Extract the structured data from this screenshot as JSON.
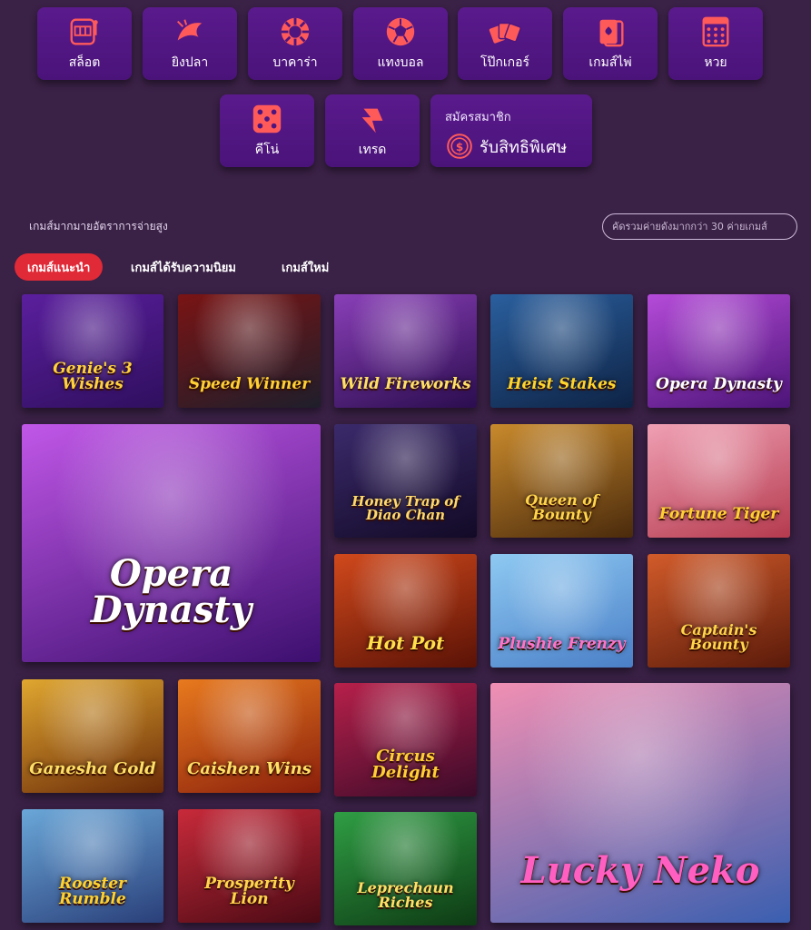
{
  "categories": [
    {
      "label": "สล็อต",
      "icon": "slot-machine-icon"
    },
    {
      "label": "ยิงปลา",
      "icon": "fish-icon"
    },
    {
      "label": "บาคาร่า",
      "icon": "baccarat-chip-icon"
    },
    {
      "label": "แทงบอล",
      "icon": "soccer-ball-icon"
    },
    {
      "label": "โป๊กเกอร์",
      "icon": "poker-cards-icon"
    },
    {
      "label": "เกมส์ไพ่",
      "icon": "playing-cards-icon"
    },
    {
      "label": "หวย",
      "icon": "lottery-ticket-icon"
    },
    {
      "label": "คีโน่",
      "icon": "dice-icon"
    },
    {
      "label": "เทรด",
      "icon": "trade-chart-icon"
    }
  ],
  "member": {
    "top": "สมัครสมาชิก",
    "main": "รับสิทธิพิเศษ",
    "icon": "coin-icon"
  },
  "section": {
    "title": "เกมส์มากมายอัตราการจ่ายสูง",
    "search_placeholder": "คัดรวมค่ายดังมากกว่า 30 ค่ายเกมส์"
  },
  "tabs": [
    {
      "label": "เกมส์แนะนำ",
      "active": true
    },
    {
      "label": "เกมส์ได้รับความนิยม",
      "active": false
    },
    {
      "label": "เกมส์ใหม่",
      "active": false
    }
  ],
  "games": [
    {
      "name": "Genie's 3 Wishes",
      "colors": [
        "#5b1f9e",
        "#2f0f5e"
      ],
      "text": "#ffd23d"
    },
    {
      "name": "Speed Winner",
      "colors": [
        "#7a1414",
        "#1e1e2b"
      ],
      "text": "#ffcf33"
    },
    {
      "name": "Wild Fireworks",
      "colors": [
        "#8a3fb8",
        "#2b0d4f"
      ],
      "text": "#ffe066"
    },
    {
      "name": "Heist Stakes",
      "colors": [
        "#2a5f9e",
        "#0e2345"
      ],
      "text": "#ffd52b"
    },
    {
      "name": "Opera Dynasty",
      "colors": [
        "#b54bd9",
        "#4c1478"
      ],
      "text": "#ffffff"
    },
    {
      "name": "Opera Dynasty",
      "colors": [
        "#c157e8",
        "#3c0f6e"
      ],
      "text": "#ffffff"
    },
    {
      "name": "Honey Trap of Diao Chan",
      "colors": [
        "#3b2a6b",
        "#120a26"
      ],
      "text": "#ffd96b"
    },
    {
      "name": "Queen of Bounty",
      "colors": [
        "#c98a2c",
        "#4a2a0c"
      ],
      "text": "#ffd54a"
    },
    {
      "name": "Fortune Tiger",
      "colors": [
        "#f0a0b4",
        "#b53a4e"
      ],
      "text": "#ffd12e"
    },
    {
      "name": "Hot Pot",
      "colors": [
        "#d1491c",
        "#5a1206"
      ],
      "text": "#ffdf4a"
    },
    {
      "name": "Plushie Frenzy",
      "colors": [
        "#8ec9f2",
        "#4a7fc7"
      ],
      "text": "#ff73c6"
    },
    {
      "name": "Captain's Bounty",
      "colors": [
        "#d25b2a",
        "#5a1a0a"
      ],
      "text": "#ffd54a"
    },
    {
      "name": "Ganesha Gold",
      "colors": [
        "#e0a730",
        "#6a2a08"
      ],
      "text": "#ffe066"
    },
    {
      "name": "Caishen Wins",
      "colors": [
        "#e87a1e",
        "#8a1f0c"
      ],
      "text": "#ffe066"
    },
    {
      "name": "Circus Delight",
      "colors": [
        "#b7204a",
        "#3b0b2a"
      ],
      "text": "#ffcf33"
    },
    {
      "name": "Lucky Neko",
      "colors": [
        "#f18fb3",
        "#3a5fb0"
      ],
      "text": "#ff5fc1"
    },
    {
      "name": "Rooster Rumble",
      "colors": [
        "#6aa7d8",
        "#2a3f7a"
      ],
      "text": "#ffd12e"
    },
    {
      "name": "Prosperity Lion",
      "colors": [
        "#c82a3a",
        "#4a0a14"
      ],
      "text": "#ffd54a"
    },
    {
      "name": "Leprechaun Riches",
      "colors": [
        "#2f9e44",
        "#0e3a14"
      ],
      "text": "#ffe066"
    }
  ]
}
